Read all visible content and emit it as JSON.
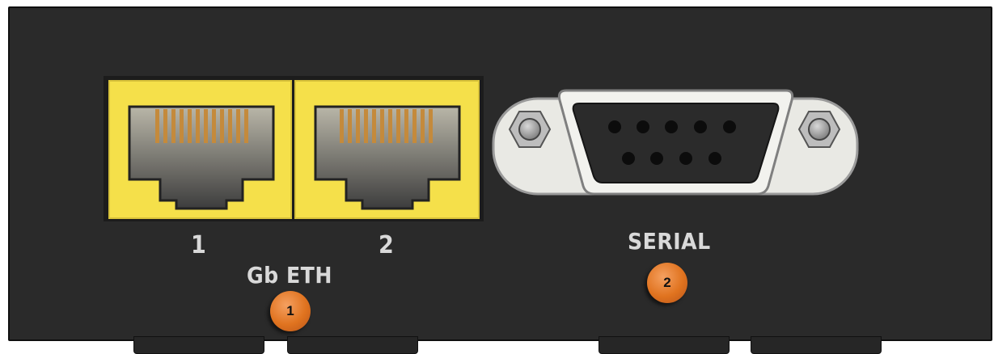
{
  "ports": {
    "eth_port_1_label": "1",
    "eth_port_2_label": "2",
    "eth_group_label": "Gb ETH",
    "serial_label": "SERIAL"
  },
  "callouts": {
    "eth_number": "1",
    "serial_number": "2"
  },
  "colors": {
    "panel": "#2a2a2a",
    "eth_port_body": "#f5e04a",
    "label_text": "#d9d9d9",
    "callout": "#e0731f"
  }
}
